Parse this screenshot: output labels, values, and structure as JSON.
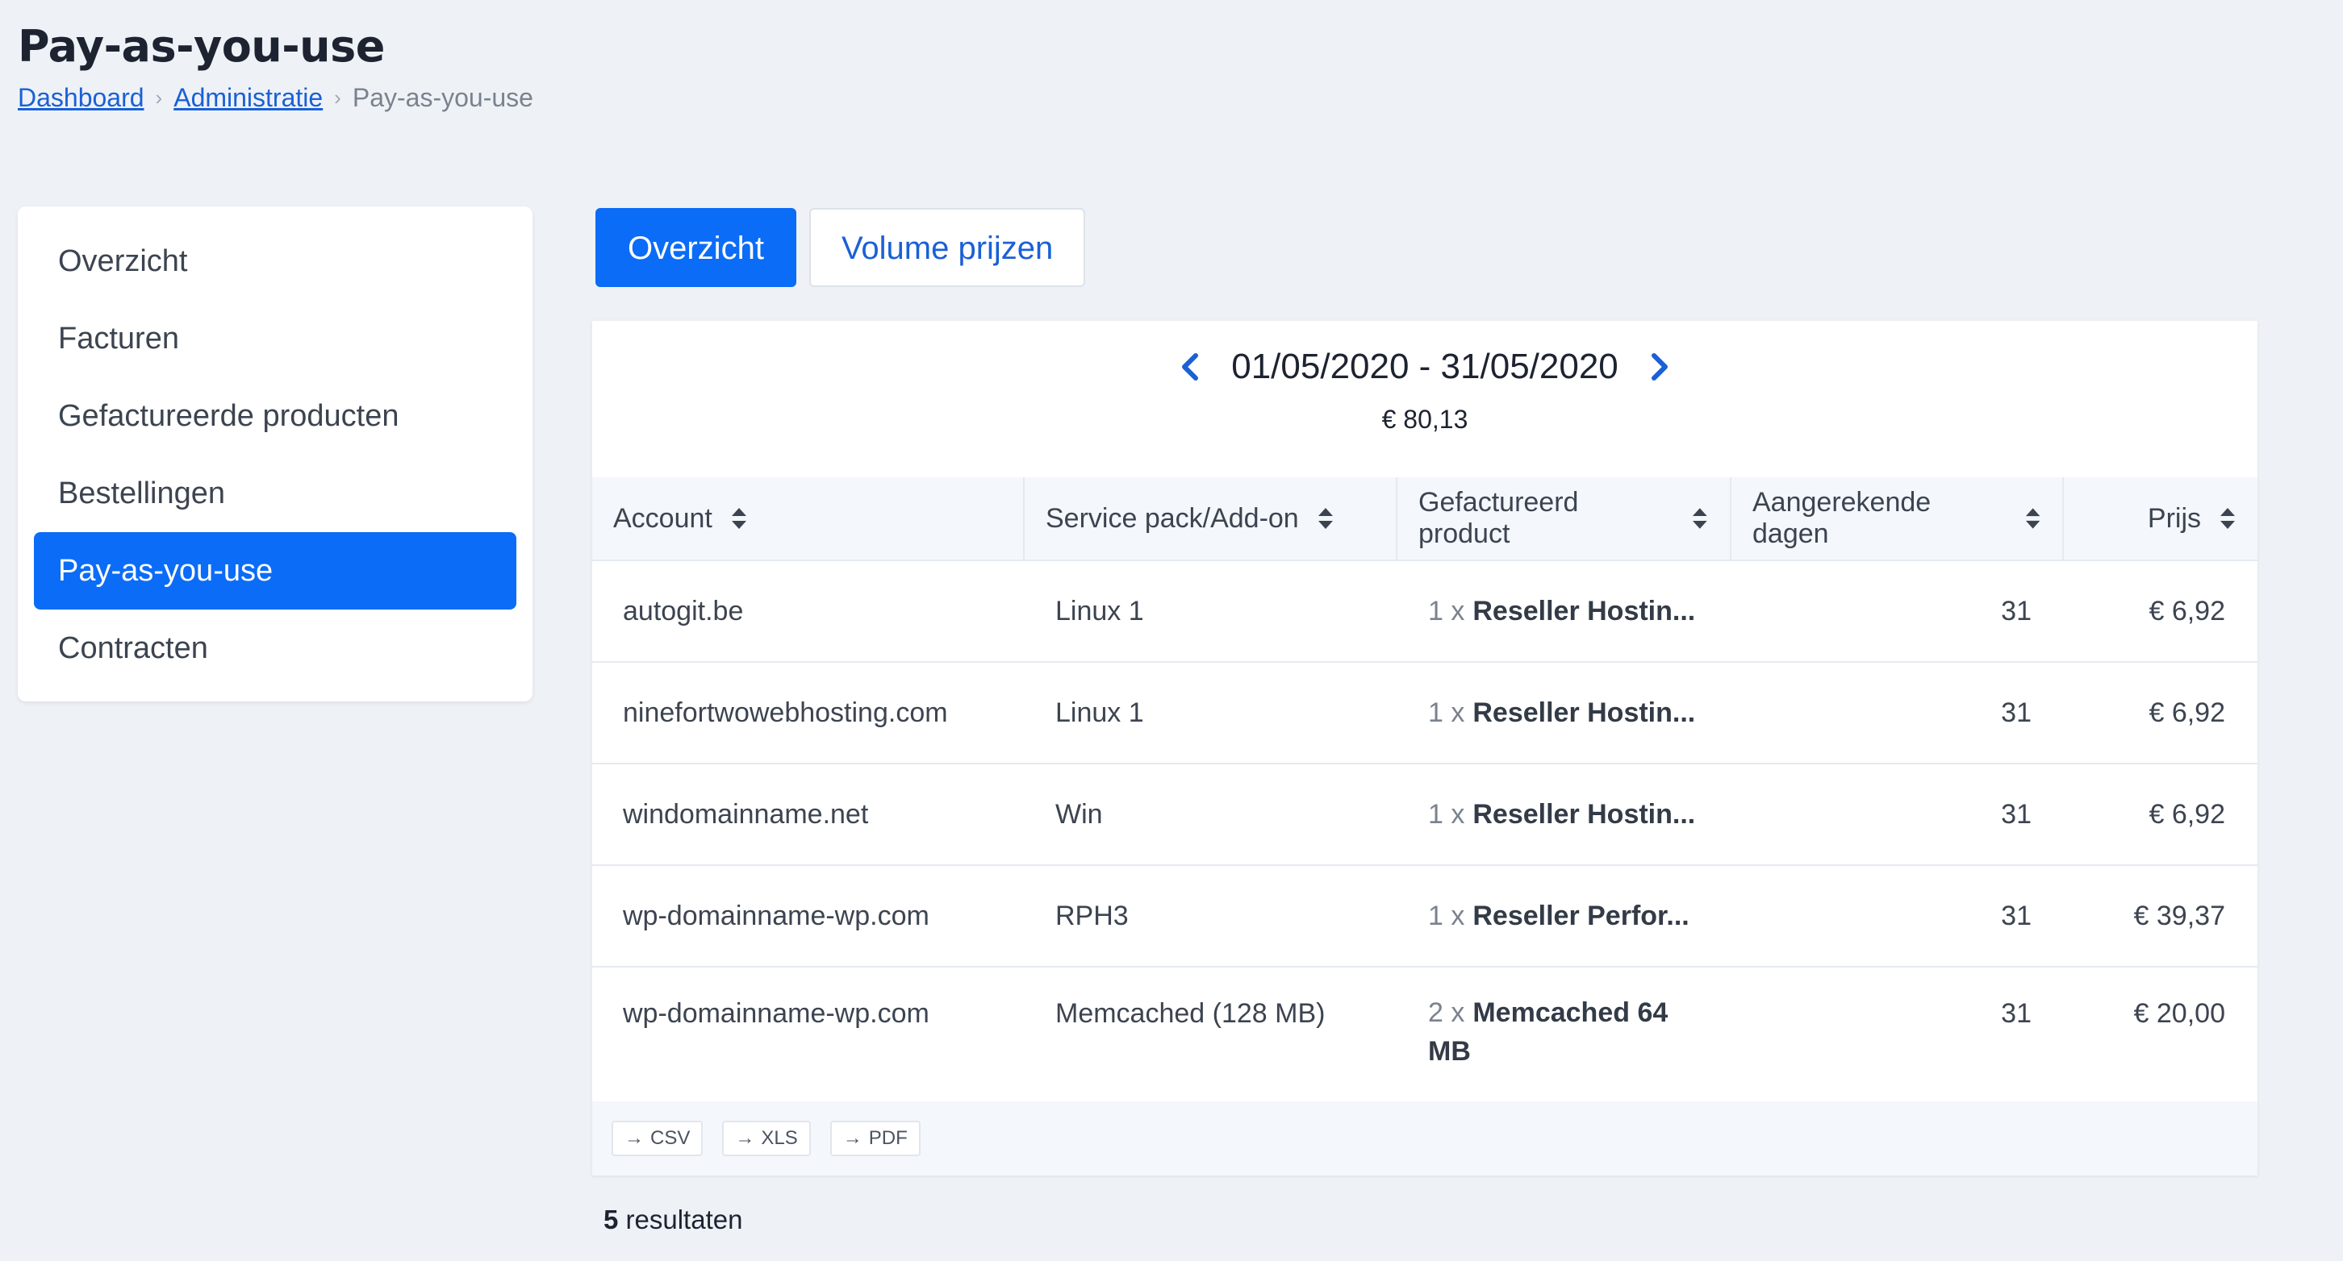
{
  "page": {
    "title": "Pay-as-you-use"
  },
  "breadcrumb": {
    "items": [
      "Dashboard",
      "Administratie"
    ],
    "current": "Pay-as-you-use"
  },
  "sidebar": {
    "items": [
      {
        "label": "Overzicht"
      },
      {
        "label": "Facturen"
      },
      {
        "label": "Gefactureerde producten"
      },
      {
        "label": "Bestellingen"
      },
      {
        "label": "Pay-as-you-use",
        "active": true
      },
      {
        "label": "Contracten"
      }
    ]
  },
  "tabs": [
    {
      "label": "Overzicht",
      "active": true
    },
    {
      "label": "Volume prijzen",
      "active": false
    }
  ],
  "period": {
    "range": "01/05/2020 - 31/05/2020",
    "total": "€ 80,13"
  },
  "table": {
    "headers": [
      "Account",
      "Service pack/Add-on",
      "Gefactureerd product",
      "Aangerekende dagen",
      "Prijs"
    ],
    "rows": [
      {
        "account": "autogit.be",
        "service": "Linux 1",
        "qty": "1 x",
        "product": "Reseller Hostin...",
        "days": "31",
        "price": "€ 6,92"
      },
      {
        "account": "ninefortwowebhosting.com",
        "service": "Linux 1",
        "qty": "1 x",
        "product": "Reseller Hostin...",
        "days": "31",
        "price": "€ 6,92"
      },
      {
        "account": "windomainname.net",
        "service": "Win",
        "qty": "1 x",
        "product": "Reseller Hostin...",
        "days": "31",
        "price": "€ 6,92"
      },
      {
        "account": "wp-domainname-wp.com",
        "service": "RPH3",
        "qty": "1 x",
        "product": "Reseller Perfor...",
        "days": "31",
        "price": "€ 39,37"
      },
      {
        "account": "wp-domainname-wp.com",
        "service": "Memcached (128 MB)",
        "qty": "2 x",
        "product": "Memcached 64",
        "product_line2": "MB",
        "days": "31",
        "price": "€ 20,00"
      }
    ]
  },
  "exports": [
    "CSV",
    "XLS",
    "PDF"
  ],
  "results": {
    "count": "5",
    "label": "resultaten"
  },
  "colors": {
    "accent": "#0b6cf7",
    "link": "#1a60d6",
    "background": "#eef2f6"
  },
  "icons": {
    "prev": "chevron-left-icon",
    "next": "chevron-right-icon",
    "sort": "sort-icon",
    "export": "arrow-right-icon"
  }
}
